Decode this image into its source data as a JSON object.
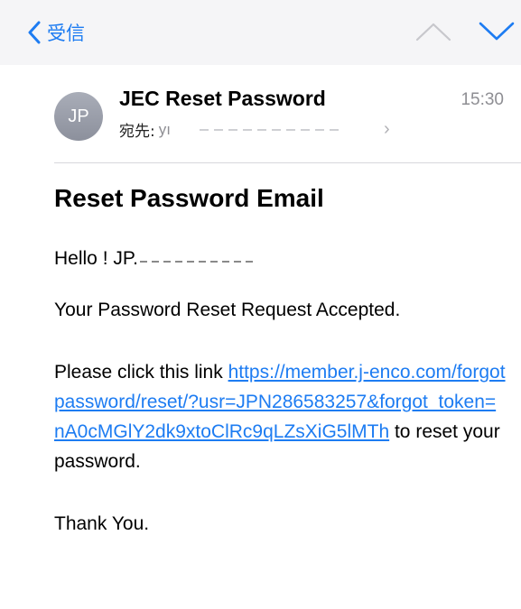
{
  "navbar": {
    "back_label": "受信"
  },
  "message": {
    "avatar_initials": "JP",
    "sender": "JEC Reset Password",
    "time": "15:30",
    "to_label": "宛先:",
    "to_value_visible": "yı"
  },
  "body": {
    "heading": "Reset Password Email",
    "greeting": "Hello ! JP.",
    "accepted": "Your Password Reset Request Accepted.",
    "click_prefix": "Please click this link ",
    "link": "https://member.j-enco.com/forgotpassword/reset/?usr=JPN286583257&forgot_token=nA0cMGlY2dk9xtoClRc9qLZsXiG5lMTh",
    "click_suffix": " to reset your password.",
    "thanks": "Thank You."
  },
  "colors": {
    "accent": "#1d7cf2",
    "secondary_text": "#8e8e93",
    "navbar_bg": "#f5f5f7"
  },
  "icons": {
    "back": "chevron-left-icon",
    "prev": "chevron-up-icon",
    "next": "chevron-down-icon",
    "recipient_more": "chevron-right-icon"
  }
}
